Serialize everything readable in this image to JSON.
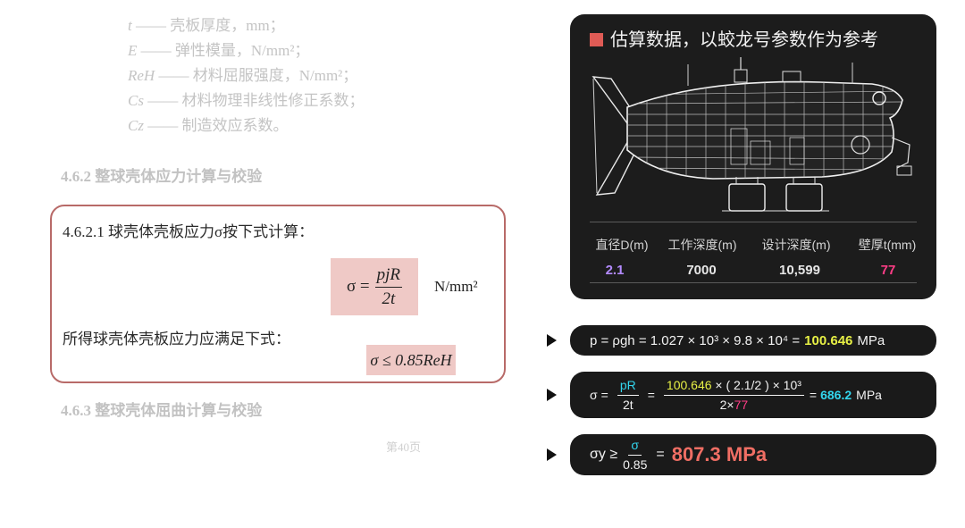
{
  "doc": {
    "faded_lines": [
      {
        "sym": "t",
        "text": "—— 壳板厚度，mm；"
      },
      {
        "sym": "E",
        "text": "—— 弹性模量，N/mm²；"
      },
      {
        "sym": "ReH",
        "text": "—— 材料屈服强度，N/mm²；"
      },
      {
        "sym": "Cs",
        "text": "—— 材料物理非线性修正系数；"
      },
      {
        "sym": "Cz",
        "text": "—— 制造效应系数。"
      }
    ],
    "section_462": "4.6.2   整球壳体应力计算与校验",
    "clause_4621": "4.6.2.1   球壳体壳板应力σ按下式计算：",
    "formula_lhs": "σ =",
    "formula_num": "pjR",
    "formula_den": "2t",
    "formula_unit": "N/mm²",
    "condition_text": "所得球壳体壳板应力应满足下式：",
    "condition_formula": "σ ≤ 0.85ReH",
    "section_463": "4.6.3   整球壳体屈曲计算与校验",
    "page_number": "第40页"
  },
  "card": {
    "title": "估算数据，以蛟龙号参数作为参考",
    "headers": [
      "直径D(m)",
      "工作深度(m)",
      "设计深度(m)",
      "壁厚t(mm)"
    ],
    "values": [
      "2.1",
      "7000",
      "10,599",
      "77"
    ],
    "colors": {
      "diameter": "#b48bff",
      "thickness": "#ff3d86",
      "accent_square": "#df5b55"
    }
  },
  "formulas": {
    "f1_left": "p = ρgh = 1.027 × 10³ × 9.8 × 10⁴ =",
    "f1_result": "100.646",
    "f1_unit": "MPa",
    "f2_sigma": "σ",
    "f2_eq": "=",
    "f2_pR_num": "pR",
    "f2_pR_den": "2t",
    "f2_big_num_val": "100.646",
    "f2_big_num_rest": "× ( 2.1/2 ) × 10³",
    "f2_big_den_pre": "2×",
    "f2_big_den_t": "77",
    "f2_eq2": "=",
    "f2_result": "686.2",
    "f2_unit": "MPa",
    "f3_left": "σy ≥",
    "f3_num": "σ",
    "f3_den": "0.85",
    "f3_eq": "=",
    "f3_result": "807.3 MPa"
  }
}
